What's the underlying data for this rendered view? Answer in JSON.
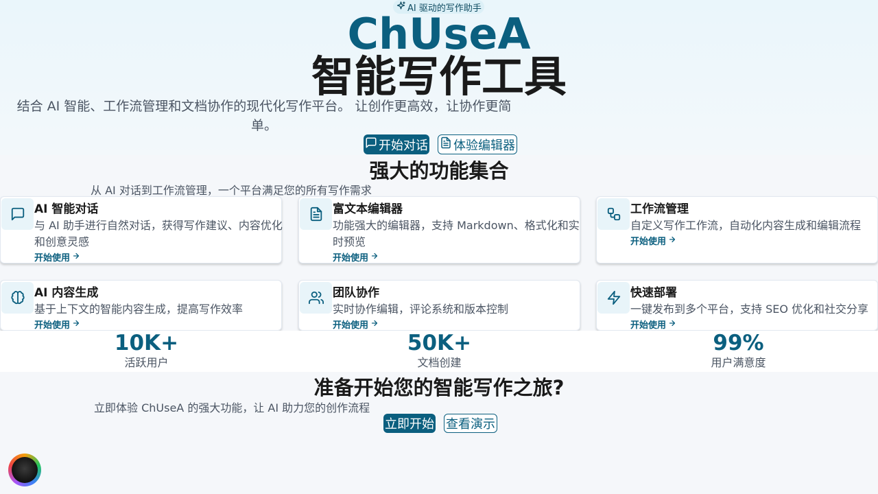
{
  "hero": {
    "badge": "AI 驱动的写作助手",
    "brand": "ChUseA",
    "title": "智能写作工具",
    "subtitle_line1": "结合 AI 智能、工作流管理和文档协作的现代化写作平台。 让创作更高效，让协作更简",
    "subtitle_line2": "单。",
    "primary_button": "开始对话",
    "secondary_button": "体验编辑器"
  },
  "features": {
    "title": "强大的功能集合",
    "subtitle": "从 AI 对话到工作流管理，一个平台满足您的所有写作需求",
    "link_label": "开始使用",
    "items": [
      {
        "title": "AI 智能对话",
        "desc": "与 AI 助手进行自然对话，获得写作建议、内容优化和创意灵感",
        "icon": "message-square-icon"
      },
      {
        "title": "富文本编辑器",
        "desc": "功能强大的编辑器，支持 Markdown、格式化和实时预览",
        "icon": "file-text-icon"
      },
      {
        "title": "工作流管理",
        "desc": "自定义写作工作流，自动化内容生成和编辑流程",
        "icon": "workflow-icon"
      },
      {
        "title": "AI 内容生成",
        "desc": "基于上下文的智能内容生成，提高写作效率",
        "icon": "brain-icon"
      },
      {
        "title": "团队协作",
        "desc": "实时协作编辑，评论系统和版本控制",
        "icon": "users-icon"
      },
      {
        "title": "快速部署",
        "desc": "一键发布到多个平台，支持 SEO 优化和社交分享",
        "icon": "zap-icon"
      }
    ]
  },
  "stats": [
    {
      "value": "10K+",
      "label": "活跃用户"
    },
    {
      "value": "50K+",
      "label": "文档创建"
    },
    {
      "value": "99%",
      "label": "用户满意度"
    }
  ],
  "cta": {
    "title": "准备开始您的智能写作之旅?",
    "subtitle": "立即体验 ChUseA 的强大功能，让 AI 助力您的创作流程",
    "primary_button": "立即开始",
    "secondary_button": "查看演示"
  },
  "colors": {
    "primary": "#0b5f7f",
    "hero_bg": "#eaf6fb",
    "page_bg": "#f5f7fa"
  }
}
